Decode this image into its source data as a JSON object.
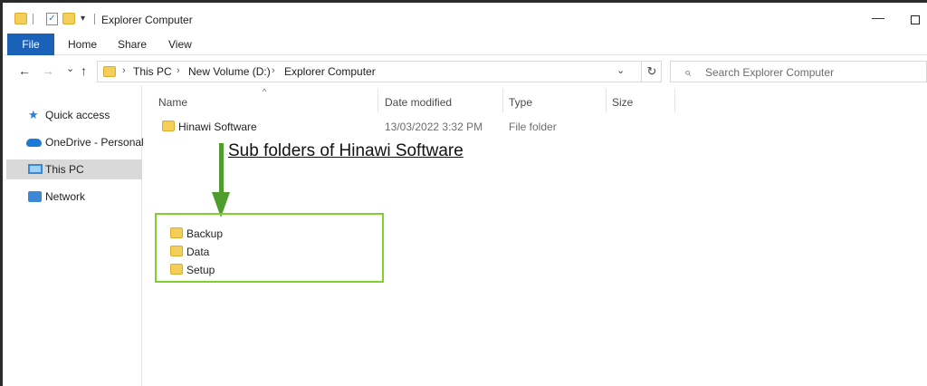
{
  "window": {
    "title": "Explorer Computer",
    "minimize_glyph": "—",
    "qa_check_glyph": "✓",
    "qa_dropdown_glyph": "▾"
  },
  "ribbon": {
    "tabs": [
      "File",
      "Home",
      "Share",
      "View"
    ]
  },
  "address": {
    "back_glyph": "←",
    "forward_glyph": "→",
    "recent_glyph": "⌄",
    "up_glyph": "↑",
    "separator_glyph": "›",
    "breadcrumbs": [
      "This PC",
      "New Volume (D:)",
      "Explorer Computer"
    ],
    "dropdown_glyph": "⌄",
    "refresh_glyph": "↻",
    "search_glyph": "⌕",
    "search_placeholder": "Search Explorer Computer"
  },
  "nav_pane": {
    "star_glyph": "★",
    "items": [
      {
        "label": "Quick access",
        "icon": "star-icon"
      },
      {
        "label": "OneDrive - Personal",
        "icon": "cloud-icon"
      },
      {
        "label": "This PC",
        "icon": "computer-icon",
        "selected": true
      },
      {
        "label": "Network",
        "icon": "network-icon"
      }
    ]
  },
  "columns": {
    "sort_glyph": "^",
    "headers": [
      "Name",
      "Date modified",
      "Type",
      "Size"
    ]
  },
  "files": [
    {
      "name": "Hinawi Software",
      "date_modified": "13/03/2022 3:32 PM",
      "type": "File folder"
    }
  ],
  "annotation": {
    "text": "Sub folders of Hinawi Software",
    "subfolders": [
      "Backup",
      "Data",
      "Setup"
    ],
    "arrow_color": "#4e9d2d",
    "box_color": "#7fd02b"
  },
  "colors": {
    "accent": "#1a62b8",
    "folder": "#f3cf5a"
  }
}
